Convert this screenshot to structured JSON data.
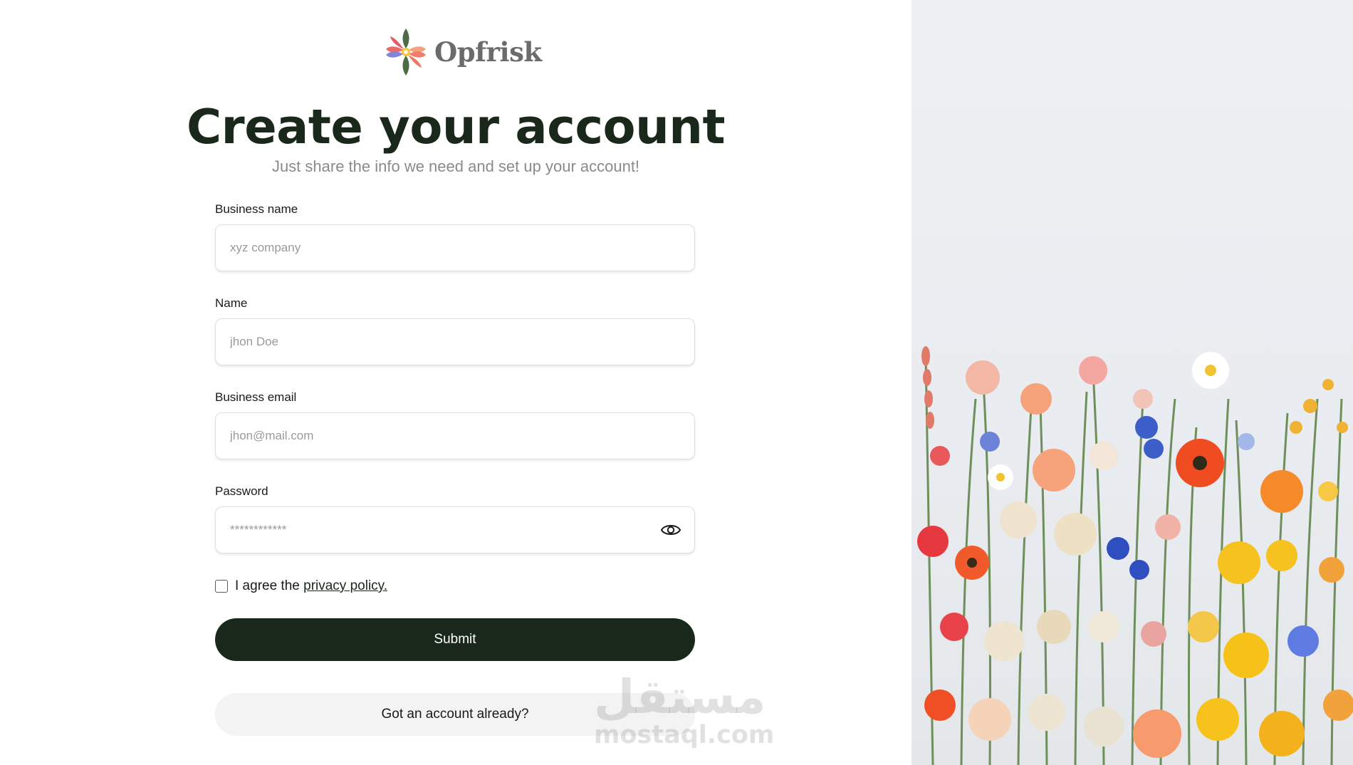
{
  "brand": {
    "name": "Opfrisk",
    "logo_icon": "flower-logo-icon"
  },
  "header": {
    "title": "Create your account",
    "subtitle": "Just share the info we need and set up your account!"
  },
  "form": {
    "business_name": {
      "label": "Business name",
      "placeholder": "xyz company",
      "value": ""
    },
    "name": {
      "label": "Name",
      "placeholder": "jhon Doe",
      "value": ""
    },
    "business_email": {
      "label": "Business email",
      "placeholder": "jhon@mail.com",
      "value": ""
    },
    "password": {
      "label": "Password",
      "placeholder": "************",
      "value": "",
      "toggle_icon": "eye-icon"
    },
    "agree": {
      "text": "I agree the ",
      "link": "privacy policy.",
      "checked": false
    },
    "submit_label": "Submit",
    "login_label": "Got an account already?"
  },
  "watermark": {
    "arabic": "مستقل",
    "latin": "mostaql.com"
  },
  "colors": {
    "primary": "#19281a",
    "secondary_button": "#f3f3f3",
    "muted_text": "#8a8a8a"
  }
}
